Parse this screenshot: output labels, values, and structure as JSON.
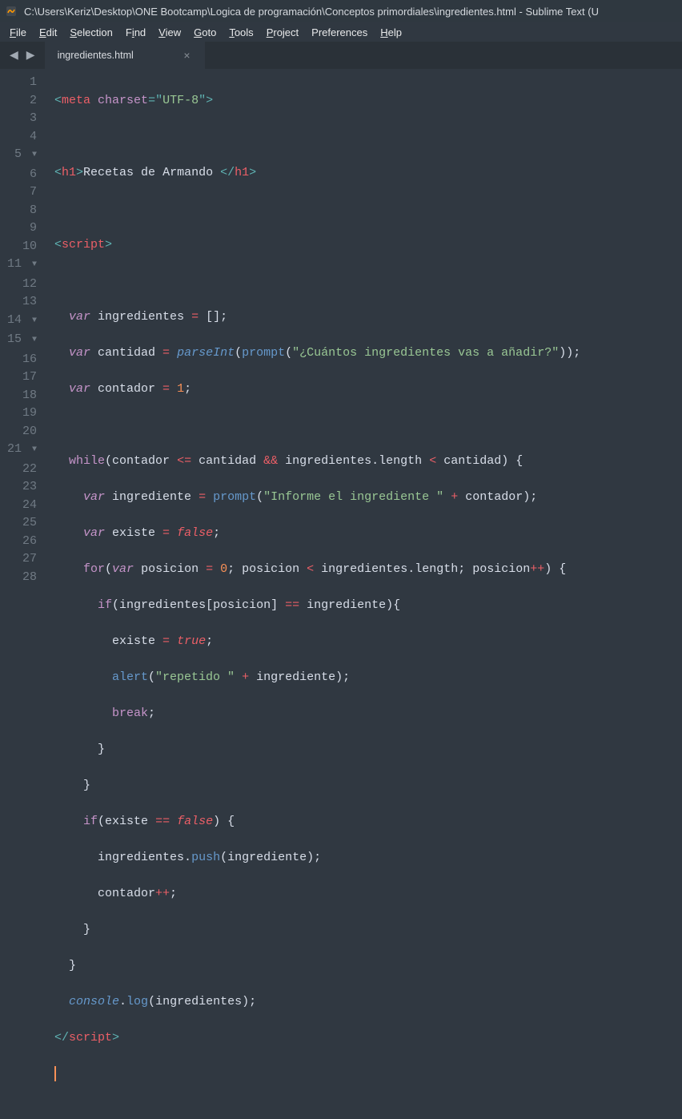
{
  "window": {
    "title": "C:\\Users\\Keriz\\Desktop\\ONE Bootcamp\\Logica de programación\\Conceptos primordiales\\ingredientes.html - Sublime Text (U"
  },
  "menu": {
    "file": "File",
    "edit": "Edit",
    "selection": "Selection",
    "find": "Find",
    "view": "View",
    "goto": "Goto",
    "tools": "Tools",
    "project": "Project",
    "preferences": "Preferences",
    "help": "Help"
  },
  "nav": {
    "back": "◀",
    "forward": "▶"
  },
  "tab": {
    "name": "ingredientes.html",
    "close": "×"
  },
  "gutter": {
    "fold_glyph": "▼",
    "lines": [
      "1",
      "2",
      "3",
      "4",
      "5",
      "6",
      "7",
      "8",
      "9",
      "10",
      "11",
      "12",
      "13",
      "14",
      "15",
      "16",
      "17",
      "18",
      "19",
      "20",
      "21",
      "22",
      "23",
      "24",
      "25",
      "26",
      "27",
      "28"
    ]
  },
  "code": {
    "l1": {
      "open": "<",
      "tag": "meta",
      "sp": " ",
      "attr": "charset",
      "eq": "=",
      "q1": "\"",
      "val": "UTF-8",
      "q2": "\"",
      "close": ">"
    },
    "l3": {
      "open": "<",
      "tag": "h1",
      "gt": ">",
      "text": "Recetas de Armando ",
      "open2": "</",
      "tag2": "h1",
      "close": ">"
    },
    "l5": {
      "open": "<",
      "tag": "script",
      "close": ">"
    },
    "l7": {
      "kw": "var",
      "sp": " ",
      "name": "ingredientes ",
      "eq": "=",
      "rest": " [];"
    },
    "l8": {
      "kw": "var",
      "name": " cantidad ",
      "eq": "=",
      "sp": " ",
      "fn": "parseInt",
      "lp": "(",
      "fn2": "prompt",
      "lp2": "(",
      "str": "\"¿Cuántos ingredientes vas a añadir?\"",
      "rp": "));"
    },
    "l9": {
      "kw": "var",
      "name": " contador ",
      "eq": "=",
      "sp": " ",
      "num": "1",
      "semi": ";"
    },
    "l11": {
      "kw": "while",
      "lp": "(",
      "v1": "contador ",
      "op1": "<=",
      "v2": " cantidad ",
      "op2": "&&",
      "v3": " ingredientes",
      "dot": ".",
      "prop": "length",
      "sp2": " ",
      "op3": "<",
      "v4": " cantidad",
      "rp": ") {"
    },
    "l12": {
      "indent": "    ",
      "kw": "var",
      "name": " ingrediente ",
      "eq": "=",
      "sp": " ",
      "fn": "prompt",
      "lp": "(",
      "str": "\"Informe el ingrediente \"",
      "sp2": " ",
      "op": "+",
      "v": " contador",
      "rp": ");"
    },
    "l13": {
      "indent": "    ",
      "kw": "var",
      "name": " existe ",
      "eq": "=",
      "sp": " ",
      "val": "false",
      "semi": ";"
    },
    "l14": {
      "indent": "    ",
      "kw": "for",
      "lp": "(",
      "kw2": "var",
      "name": " posicion ",
      "eq": "=",
      "sp": " ",
      "num": "0",
      "semi": "; ",
      "v1": "posicion ",
      "op": "<",
      "v2": " ingredientes",
      "dot": ".",
      "prop": "length",
      "semi2": "; posicion",
      "op2": "++",
      "rp": ") {"
    },
    "l15": {
      "indent": "      ",
      "kw": "if",
      "lp": "(",
      "v1": "ingredientes[posicion] ",
      "op": "==",
      "v2": " ingrediente",
      "rp": "){"
    },
    "l16": {
      "indent": "        ",
      "v": "existe ",
      "eq": "=",
      "sp": " ",
      "val": "true",
      "semi": ";"
    },
    "l17": {
      "indent": "        ",
      "fn": "alert",
      "lp": "(",
      "str": "\"repetido \"",
      "sp": " ",
      "op": "+",
      "v": " ingrediente",
      "rp": ");"
    },
    "l18": {
      "indent": "        ",
      "kw": "break",
      "semi": ";"
    },
    "l19": {
      "indent": "      ",
      "brace": "}"
    },
    "l20": {
      "indent": "    ",
      "brace": "}"
    },
    "l21": {
      "indent": "    ",
      "kw": "if",
      "lp": "(",
      "v": "existe ",
      "op": "==",
      "sp": " ",
      "val": "false",
      "rp": ") {"
    },
    "l22": {
      "indent": "      ",
      "v": "ingredientes",
      "dot": ".",
      "fn": "push",
      "lp": "(",
      "arg": "ingrediente",
      "rp": ");"
    },
    "l23": {
      "indent": "      ",
      "v": "contador",
      "op": "++",
      "semi": ";"
    },
    "l24": {
      "indent": "    ",
      "brace": "}"
    },
    "l25": {
      "indent": "  ",
      "brace": "}"
    },
    "l26": {
      "indent": "  ",
      "obj": "console",
      "dot": ".",
      "fn": "log",
      "lp": "(",
      "arg": "ingredientes",
      "rp": ");"
    },
    "l27": {
      "open": "</",
      "tag": "script",
      "close": ">"
    }
  }
}
